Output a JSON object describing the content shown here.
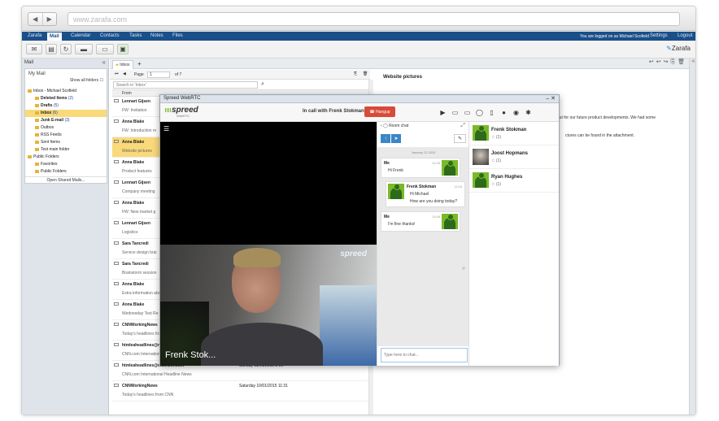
{
  "browser": {
    "url": "www.zarafa.com",
    "back_glyph": "◀",
    "forward_glyph": "▶"
  },
  "topnav": {
    "tabs": [
      "Zarafa",
      "Mail",
      "Calendar",
      "Contacts",
      "Tasks",
      "Notes",
      "Files"
    ],
    "active": "Mail",
    "logged_in": "You are logged on as Michael Scofield",
    "settings": "Settings",
    "logout": "Logout"
  },
  "toolbar": {
    "brand": "Zarafa"
  },
  "left": {
    "header": "Mail",
    "collapse_glyph": "«",
    "my_mail": "My Mail",
    "show_all": "Show all folders",
    "folders": [
      {
        "label": "Inbox - Michael Scofield",
        "count": "",
        "level": 0,
        "bold": false
      },
      {
        "label": "Deleted Items",
        "count": "(2)",
        "level": 1,
        "bold": true
      },
      {
        "label": "Drafts",
        "count": "(5)",
        "level": 1,
        "bold": true
      },
      {
        "label": "Inbox",
        "count": "(6)",
        "level": 1,
        "bold": true,
        "selected": true
      },
      {
        "label": "Junk E-mail",
        "count": "(3)",
        "level": 1,
        "bold": true
      },
      {
        "label": "Outbox",
        "count": "",
        "level": 1,
        "bold": false
      },
      {
        "label": "RSS Feeds",
        "count": "",
        "level": 1,
        "bold": false
      },
      {
        "label": "Sent Items",
        "count": "",
        "level": 1,
        "bold": false
      },
      {
        "label": "Test main folder",
        "count": "",
        "level": 1,
        "bold": false
      },
      {
        "label": "Public Folders",
        "count": "",
        "level": 0,
        "bold": false
      },
      {
        "label": "Favorites",
        "count": "",
        "level": 1,
        "bold": false
      },
      {
        "label": "Public Folders",
        "count": "",
        "level": 1,
        "bold": false
      }
    ],
    "open_shared": "Open Shared Mails..."
  },
  "mail": {
    "tab": "Inbox",
    "add_tab": "+",
    "page_label": "Page",
    "page": "1",
    "page_of": "of 7",
    "search_placeholder": "Search in 'Inbox'",
    "from_header": "From",
    "rows": [
      {
        "from": "Lennart Gijsen",
        "subject": "FW: Invitation",
        "date": "",
        "selected": false
      },
      {
        "from": "Anna Blake",
        "subject": "FW: Introduction m",
        "date": "",
        "selected": false
      },
      {
        "from": "Anna Blake",
        "subject": "Website pictures",
        "date": "",
        "selected": true
      },
      {
        "from": "Anna Blake",
        "subject": "Product features",
        "date": "",
        "selected": false
      },
      {
        "from": "Lennart Gijsen",
        "subject": "Company meeting",
        "date": "",
        "selected": false
      },
      {
        "from": "Anna Blake",
        "subject": "FW: New market g",
        "date": "",
        "selected": false
      },
      {
        "from": "Lennart Gijsen",
        "subject": "Logistics",
        "date": "",
        "selected": false
      },
      {
        "from": "Sara Tancredi",
        "subject": "Service design brai",
        "date": "",
        "selected": false
      },
      {
        "from": "Sara Tancredi",
        "subject": "Brainstorm session",
        "date": "",
        "selected": false
      },
      {
        "from": "Anna Blake",
        "subject": "Extra information abo",
        "date": "",
        "selected": false
      },
      {
        "from": "Anna Blake",
        "subject": "Wednesday Test Re",
        "date": "",
        "selected": false
      },
      {
        "from": "CNNWorkingNews",
        "subject": "Today's headlines fro",
        "date": "",
        "selected": false
      },
      {
        "from": "htmleaheadlines@ma",
        "subject": "CNN.com International",
        "date": "",
        "selected": false
      },
      {
        "from": "htmleaheadlines@mail.cnn.com",
        "subject": "CNN.com International Headline News",
        "date": "Sunday 11/01/2015 2:01",
        "selected": false
      },
      {
        "from": "CNNWorkingNews",
        "subject": "Today's headlines from CNN",
        "date": "Saturday 10/01/2015 11:31",
        "selected": false
      }
    ]
  },
  "preview": {
    "title": "Website pictures",
    "line1": "input for our future product developments. We had some",
    "line2": "ctures can be found in the attachment."
  },
  "webrtc": {
    "title": "Spreed WebRTC",
    "logo": "spreed",
    "logo_sub": "WebRTC",
    "in_call": "In call with Frenk Stokman",
    "hangup": "Hangup",
    "menu_glyph": "☰",
    "video_name": "Frenk Stok...",
    "video_brand": "spreed",
    "icons": [
      {
        "name": "youtube-icon",
        "glyph": "▶"
      },
      {
        "name": "folder-icon",
        "glyph": "▭"
      },
      {
        "name": "screen-icon",
        "glyph": "▭"
      },
      {
        "name": "chat-icon",
        "glyph": "◯"
      },
      {
        "name": "bookmark-icon",
        "glyph": "▯"
      },
      {
        "name": "microphone-icon",
        "glyph": "●"
      },
      {
        "name": "eye-icon",
        "glyph": "◉"
      },
      {
        "name": "gear-icon",
        "glyph": "✱"
      }
    ],
    "chat": {
      "title": "Room chat",
      "back_glyph": "‹",
      "expand_glyph": "⤢",
      "share_glyph": "↑",
      "send_glyph": "➤",
      "clear_glyph": "✎",
      "date": "January 11 2015",
      "messages": [
        {
          "who": "Me",
          "text": "Hi Frenk",
          "time": "11:03",
          "align": "left"
        },
        {
          "who": "Frenk Stokman",
          "text1": "Hi Michael",
          "text2": "How are you doing today?",
          "time": "11:04",
          "align": "right"
        },
        {
          "who": "Me",
          "text": "I'm fine thanks!",
          "time": "11:05",
          "align": "left"
        }
      ],
      "collapse_glyph": "»",
      "input_placeholder": "Type here to chat..."
    },
    "contacts": [
      {
        "name": "Frenk Stokman",
        "status": "☆ (1)",
        "avatar": "green"
      },
      {
        "name": "Joost Hopmans",
        "status": "☆ (1)",
        "avatar": "photo"
      },
      {
        "name": "Ryan Hughes",
        "status": "☆ (1)",
        "avatar": "green"
      }
    ]
  }
}
